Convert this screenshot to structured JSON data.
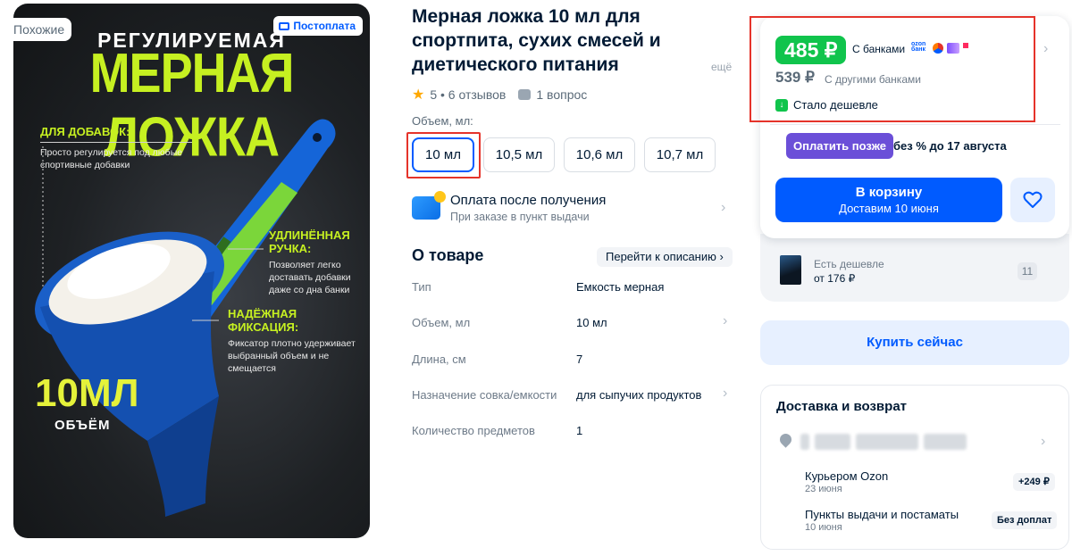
{
  "photo": {
    "similar_label": "Похожие",
    "postpay_badge": "Постоплата",
    "headline_top": "РЕГУЛИРУЕМАЯ",
    "headline_main": "МЕРНАЯ ЛОЖКА",
    "features": [
      {
        "title": "ДЛЯ ДОБАВОК:",
        "text": "Просто регулируется под любые спортивные добавки"
      },
      {
        "title": "УДЛИНЁННАЯ РУЧКА:",
        "text": "Позволяет легко доставать добавки даже со дна банки"
      },
      {
        "title": "НАДЁЖНАЯ ФИКСАЦИЯ:",
        "text": "Фиксатор плотно удерживает выбранный объем и не смещается"
      }
    ],
    "volume_big": "10МЛ",
    "volume_word": "ОБЪЁМ"
  },
  "product": {
    "title": "Мерная ложка 10 мл для спортпита, сухих смесей и диетического питания",
    "more_link": "ещё",
    "rating": "5 • 6 отзывов",
    "questions": "1 вопрос",
    "volume_label": "Объем, мл:",
    "volume_options": [
      "10 мл",
      "10,5 мл",
      "10,6 мл",
      "10,7 мл"
    ],
    "selected_volume_index": 0,
    "payment_title": "Оплата после получения",
    "payment_sub": "При заказе в пункт выдачи",
    "about_title": "О товаре",
    "goto_description": "Перейти к описанию",
    "specs": [
      {
        "key": "Тип",
        "value": "Емкость мерная"
      },
      {
        "key": "Объем, мл",
        "value": "10 мл"
      },
      {
        "key": "Длина, см",
        "value": "7"
      },
      {
        "key": "Назначение совка/емкости",
        "value": "для сыпучих продуктов"
      },
      {
        "key": "Количество предметов",
        "value": "1"
      }
    ]
  },
  "buy_box": {
    "price_bank": "485 ₽",
    "with_banks": "С банками",
    "bank_logo_text": "ozon банк",
    "price_other": "539 ₽",
    "other_banks": "С другими банками",
    "cheaper_note": "Стало дешевле",
    "pay_later": "Оплатить позже",
    "pay_later_note": "без % до 17 августа",
    "cart_label": "В корзину",
    "cart_sub": "Доставим 10 июня",
    "cheaper_label": "Есть дешевле",
    "cheaper_price": "от 176 ₽",
    "cheaper_count": "11",
    "buy_now": "Купить сейчас"
  },
  "delivery": {
    "title": "Доставка и возврат",
    "options": [
      {
        "name": "Курьером Ozon",
        "date": "23 июня",
        "tag": "+249 ₽"
      },
      {
        "name": "Пункты выдачи и постаматы",
        "date": "10 июня",
        "tag": "Без доплат"
      }
    ]
  },
  "colors": {
    "accent": "#005bff",
    "price_green": "#10c44c",
    "pay_later": "#6b4fd8",
    "highlight_red": "#e5332a",
    "image_lime": "#c6f021"
  }
}
